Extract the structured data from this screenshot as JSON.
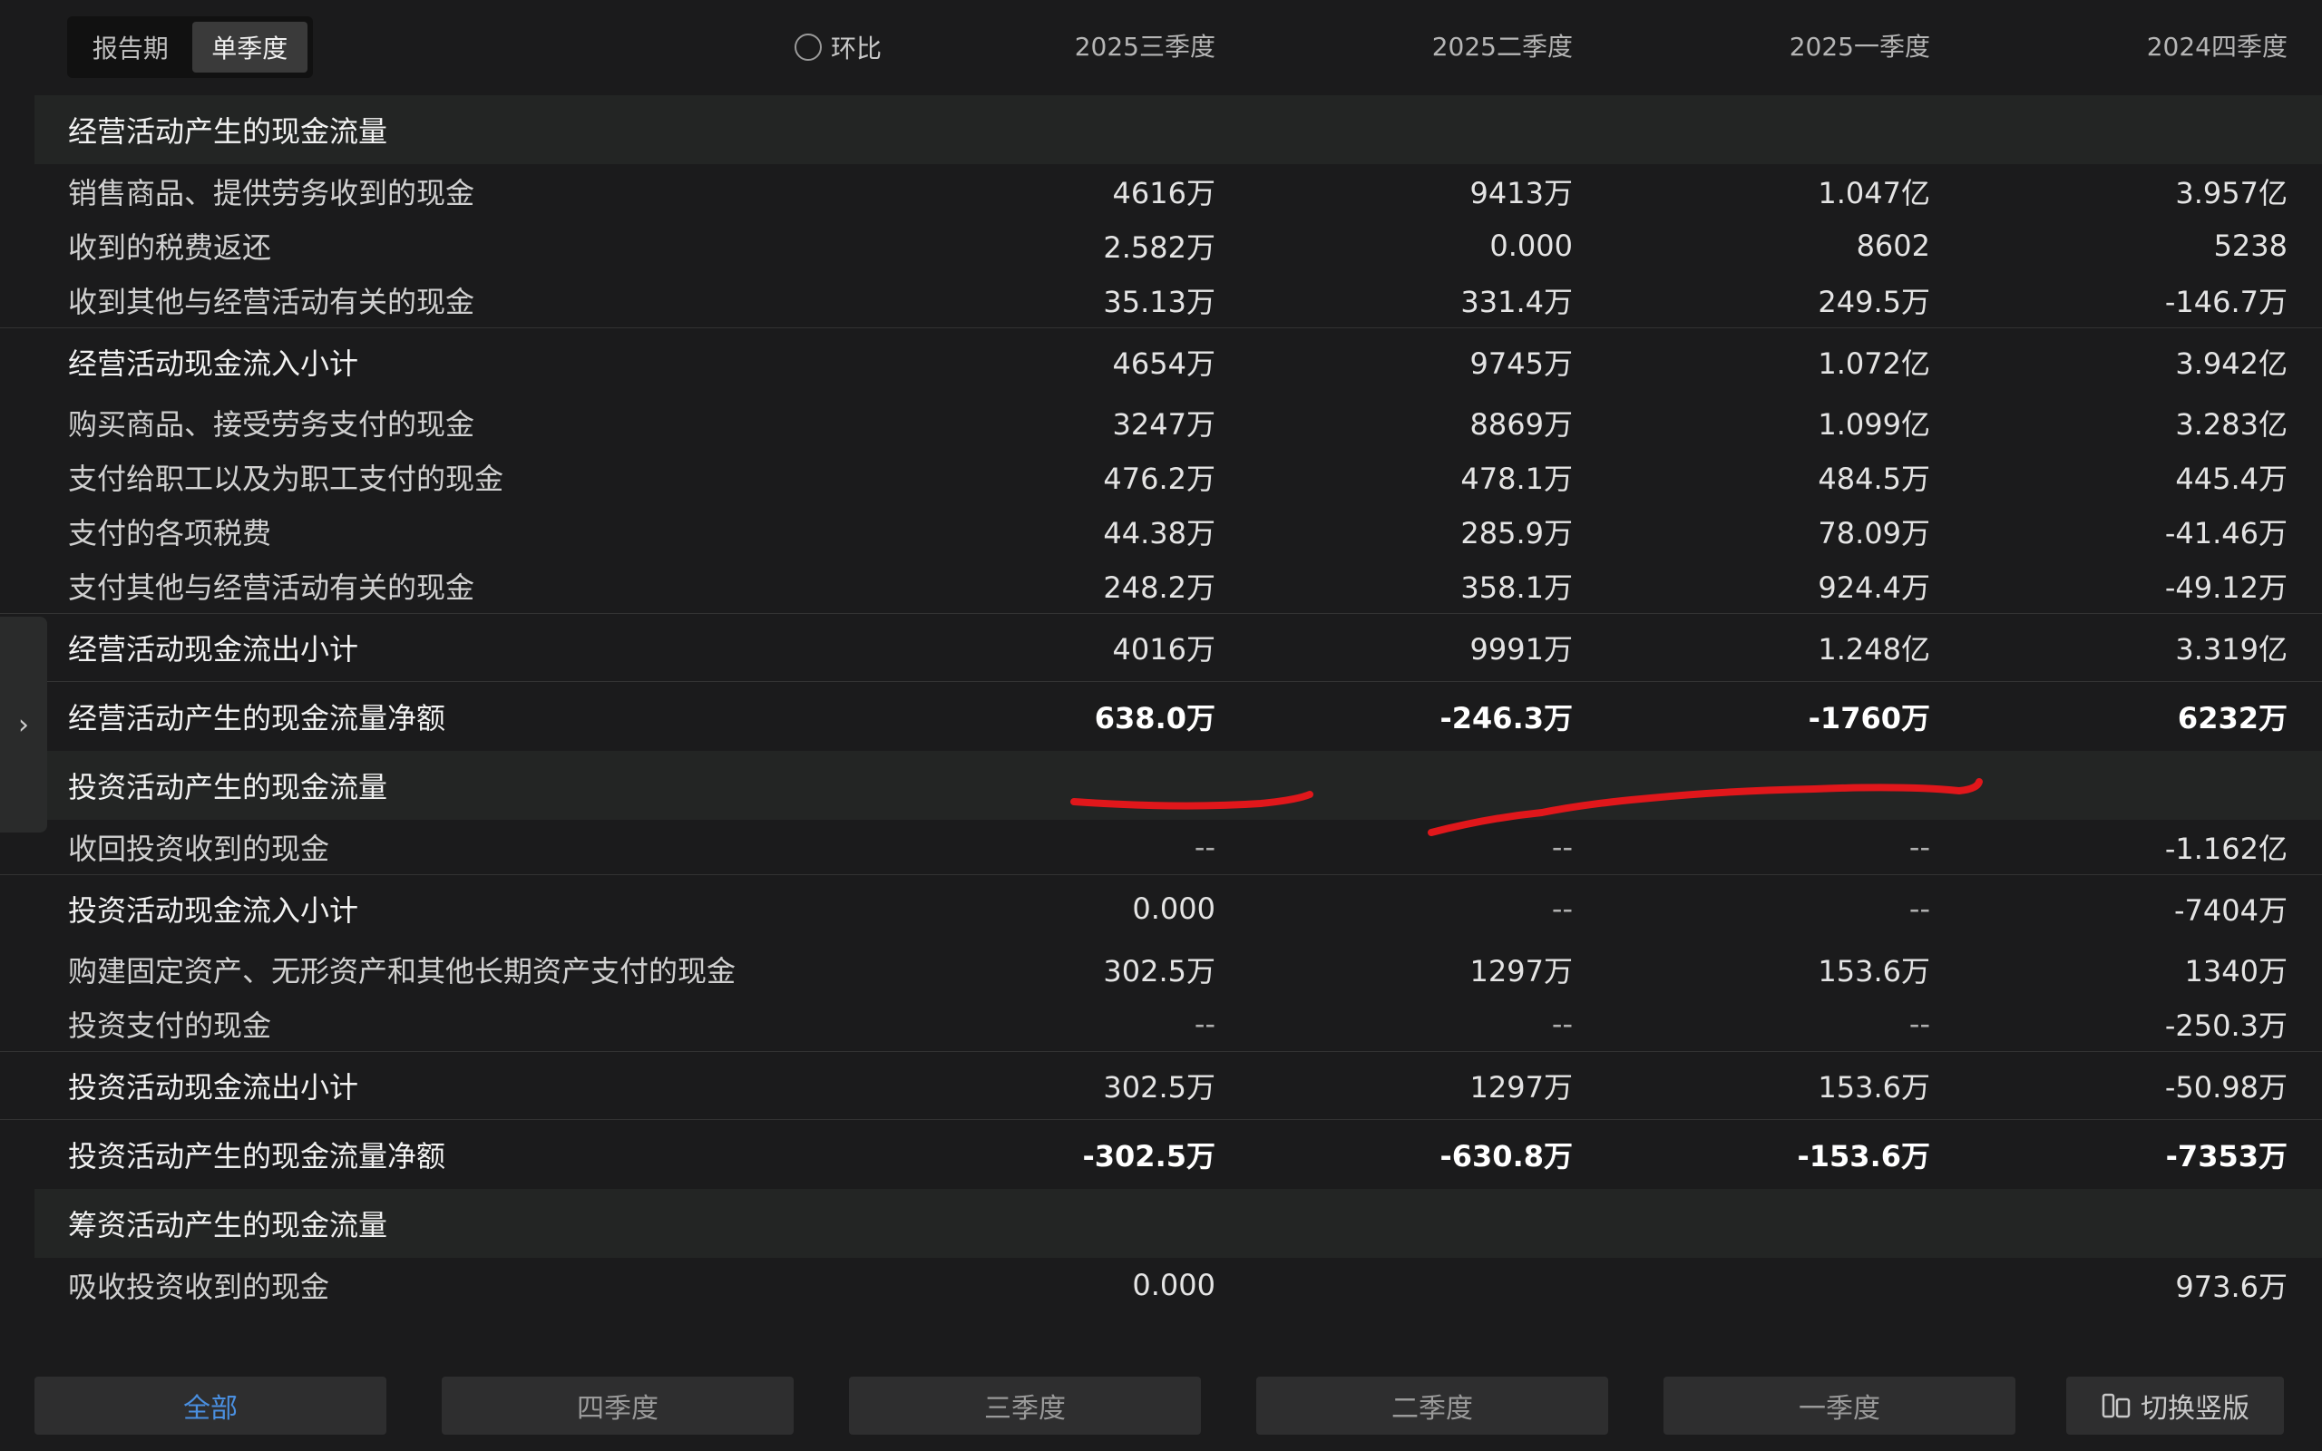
{
  "header": {
    "period_options": [
      "报告期",
      "单季度"
    ],
    "active_period": "单季度",
    "compare_label": "环比",
    "columns": [
      "2025三季度",
      "2025二季度",
      "2025一季度",
      "2024四季度"
    ]
  },
  "rows": [
    {
      "type": "section",
      "label": "经营活动产生的现金流量"
    },
    {
      "type": "item",
      "label": "销售商品、提供劳务收到的现金",
      "values": [
        "4616万",
        "9413万",
        "1.047亿",
        "3.957亿"
      ]
    },
    {
      "type": "item",
      "label": "收到的税费返还",
      "values": [
        "2.582万",
        "0.000",
        "8602",
        "5238"
      ]
    },
    {
      "type": "item",
      "label": "收到其他与经营活动有关的现金",
      "values": [
        "35.13万",
        "331.4万",
        "249.5万",
        "-146.7万"
      ]
    },
    {
      "type": "subtotal",
      "label": "经营活动现金流入小计",
      "values": [
        "4654万",
        "9745万",
        "1.072亿",
        "3.942亿"
      ]
    },
    {
      "type": "item",
      "label": "购买商品、接受劳务支付的现金",
      "values": [
        "3247万",
        "8869万",
        "1.099亿",
        "3.283亿"
      ]
    },
    {
      "type": "item",
      "label": "支付给职工以及为职工支付的现金",
      "values": [
        "476.2万",
        "478.1万",
        "484.5万",
        "445.4万"
      ]
    },
    {
      "type": "item",
      "label": "支付的各项税费",
      "values": [
        "44.38万",
        "285.9万",
        "78.09万",
        "-41.46万"
      ]
    },
    {
      "type": "item",
      "label": "支付其他与经营活动有关的现金",
      "values": [
        "248.2万",
        "358.1万",
        "924.4万",
        "-49.12万"
      ]
    },
    {
      "type": "subtotal",
      "label": "经营活动现金流出小计",
      "values": [
        "4016万",
        "9991万",
        "1.248亿",
        "3.319亿"
      ]
    },
    {
      "type": "net",
      "label": "经营活动产生的现金流量净额",
      "values": [
        "638.0万",
        "-246.3万",
        "-1760万",
        "6232万"
      ]
    },
    {
      "type": "section",
      "label": "投资活动产生的现金流量"
    },
    {
      "type": "item",
      "label": "收回投资收到的现金",
      "values": [
        "--",
        "--",
        "--",
        "-1.162亿"
      ]
    },
    {
      "type": "subtotal",
      "label": "投资活动现金流入小计",
      "values": [
        "0.000",
        "--",
        "--",
        "-7404万"
      ]
    },
    {
      "type": "item",
      "label": "购建固定资产、无形资产和其他长期资产支付的现金",
      "values": [
        "302.5万",
        "1297万",
        "153.6万",
        "1340万"
      ]
    },
    {
      "type": "item",
      "label": "投资支付的现金",
      "values": [
        "--",
        "--",
        "--",
        "-250.3万"
      ]
    },
    {
      "type": "subtotal",
      "label": "投资活动现金流出小计",
      "values": [
        "302.5万",
        "1297万",
        "153.6万",
        "-50.98万"
      ]
    },
    {
      "type": "net",
      "label": "投资活动产生的现金流量净额",
      "values": [
        "-302.5万",
        "-630.8万",
        "-153.6万",
        "-7353万"
      ]
    },
    {
      "type": "section",
      "label": "筹资活动产生的现金流量"
    },
    {
      "type": "item",
      "label": "吸收投资收到的现金",
      "values": [
        "0.000",
        "",
        "",
        "973.6万"
      ]
    }
  ],
  "bottom_tabs": [
    "全部",
    "四季度",
    "三季度",
    "二季度",
    "一季度"
  ],
  "active_tab": "全部",
  "switch_label": "切换竖版",
  "colors": {
    "background": "#1b1b1c",
    "section": "#232524",
    "accent": "#4a8fe0",
    "annotation": "#e0171b"
  }
}
